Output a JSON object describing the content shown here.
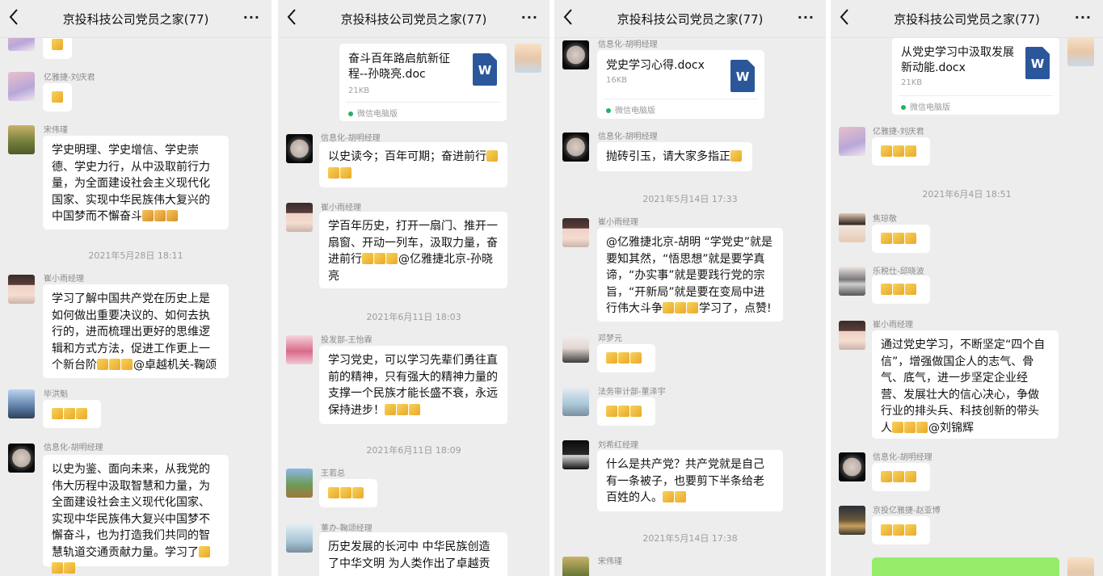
{
  "chat_title": "京投科技公司党员之家(77)",
  "more_label": "···",
  "doc_icon_label": "W",
  "panel1": {
    "n_yijie": "亿雅捷-刘庆君",
    "n_song": "宋伟瑾",
    "m_song": "学史明理、学史增信、学史崇德、学史力行，从中汲取前行力量，为全面建设社会主义现代化国家、实现中华民族伟大复兴的中国梦而不懈奋斗",
    "ts1": "2021年5月28日 18:11",
    "n_cui": "崔小雨经理",
    "m_cui": "学习了解中国共产党在历史上是如何做出重要决议的、如何去执行的，进而梳理出更好的思维逻辑和方式方法，促进工作更上一个新台阶",
    "m_cui_tail": "@卓越机关-鞠颂",
    "n_bi": "毕洪魁",
    "n_hu": "信息化-胡明经理",
    "m_hu": "以史为鉴、面向未来，从我党的伟大历程中汲取智慧和力量，为全面建设社会主义现代化国家、实现中华民族伟大复兴中国梦不懈奋斗，也为打造我们共同的智慧轨道交通贡献力量。学习了"
  },
  "panel2": {
    "file_name": "奋斗百年路启航新征程--孙晓亮.doc",
    "file_size": "21KB",
    "file_source": "微信电脑版",
    "n_hu": "信息化-胡明经理",
    "m_hu": "以史读今；百年可期；奋进前行",
    "n_cui": "崔小雨经理",
    "m_cui": "学百年历史，打开一扇门、推开一扇窗、开动一列车，汲取力量，奋进前行",
    "m_cui_tail": "@亿雅捷北京-孙晓亮",
    "ts1": "2021年6月11日 18:03",
    "n_wang": "投发部-王怡霖",
    "m_wang": "学习党史，可以学习先辈们勇往直前的精神，只有强大的精神力量的支撑一个民族才能长盛不衰，永远保持进步！",
    "ts2": "2021年6月11日 18:09",
    "n_wangzong": "王若总",
    "n_ju": "董办-鞠颂经理",
    "m_ju": "历史发展的长河中 中华民族创造了中华文明 为人类作出了卓越贡"
  },
  "panel3": {
    "n_hu_top": "信息化-胡明经理",
    "file_name": "党史学习心得.docx",
    "file_size": "16KB",
    "file_source": "微信电脑版",
    "n_hu": "信息化-胡明经理",
    "m_hu": "抛砖引玉，请大家多指正",
    "ts1": "2021年5月14日 17:33",
    "n_cui": "崔小雨经理",
    "m_cui": "@亿雅捷北京-胡明 “学党史”就是要知其然，“悟思想”就是要学真谛，“办实事”就是要践行党的宗旨，“开新局”就是要在变局中进行伟大斗争",
    "m_cui_tail": "学习了，点赞!",
    "n_deng": "邓梦元",
    "n_fawu": "法务审计部-董泽宇",
    "n_liu": "刘希红经理",
    "m_liu": "什么是共产党？共产党就是自己有一条被子，也要剪下半条给老百姓的人。",
    "ts2": "2021年5月14日 17:38",
    "n_song": "宋伟瑾"
  },
  "panel4": {
    "file_name": "从党史学习中汲取发展新动能.docx",
    "file_size": "21KB",
    "file_source": "微信电脑版",
    "n_yijie": "亿雅捷-刘庆君",
    "ts1": "2021年6月4日 18:51",
    "n_jiao": "焦琼敬",
    "n_yue": "乐税仕-邱晓波",
    "n_cui": "崔小雨经理",
    "m_cui": "通过党史学习，不断坚定“四个自信”，增强做国企人的志气、骨气、底气，进一步坚定企业经营、发展壮大的信心决心，争做行业的排头兵、科技创新的带头人",
    "m_cui_tail": "@刘锦辉",
    "n_hu": "信息化-胡明经理",
    "n_zhao": "京投亿雅捷-赵亚博"
  }
}
